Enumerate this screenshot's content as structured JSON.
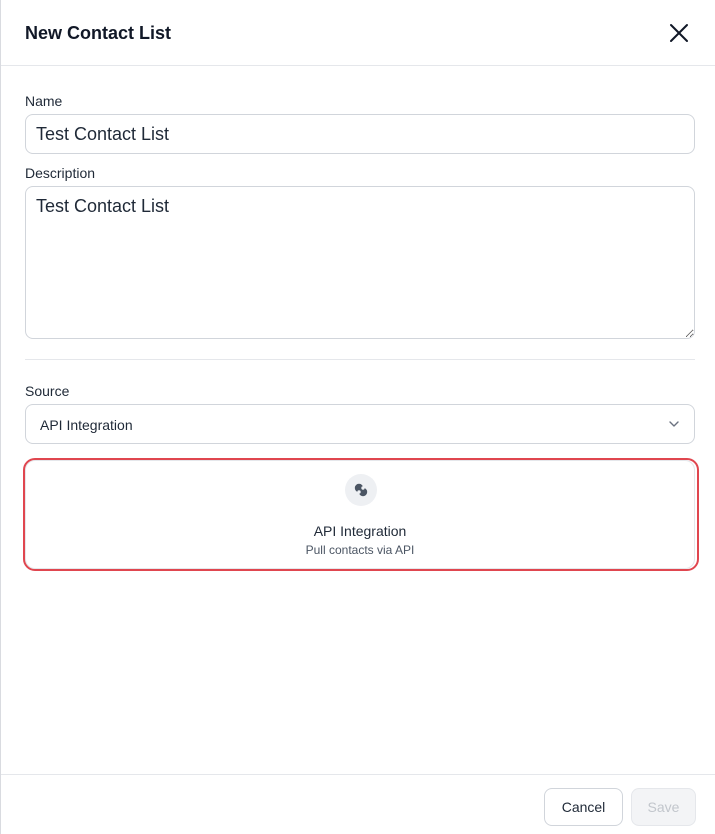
{
  "dialog": {
    "title": "New Contact List",
    "close_icon": "close-icon"
  },
  "form": {
    "name": {
      "label": "Name",
      "value": "Test Contact List"
    },
    "description": {
      "label": "Description",
      "value": "Test Contact List"
    },
    "source": {
      "label": "Source",
      "selected": "API Integration",
      "icon": "chevron-down-icon"
    }
  },
  "source_card": {
    "icon": "link-icon",
    "title": "API Integration",
    "subtitle": "Pull contacts via API",
    "highlight_color": "#e0464f"
  },
  "footer": {
    "cancel_label": "Cancel",
    "save_label": "Save"
  }
}
